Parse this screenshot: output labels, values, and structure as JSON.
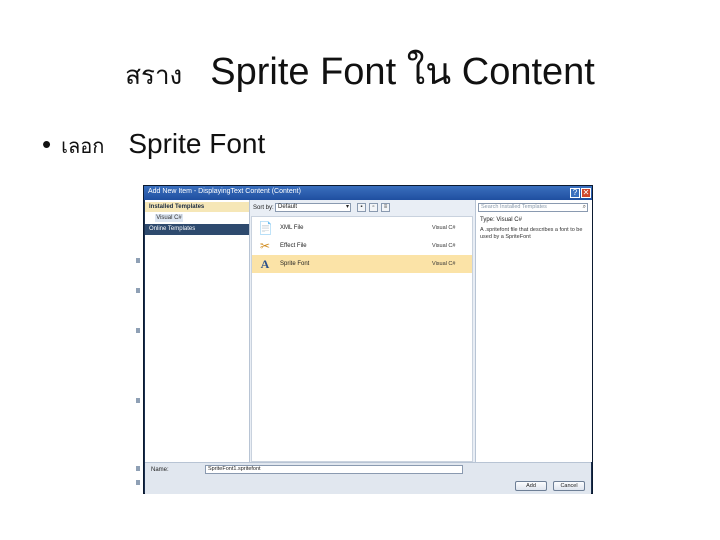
{
  "slide": {
    "title_thai": "สราง",
    "title_main": "Sprite Font ใน Content",
    "bullet_thai": "เลอก",
    "bullet_main": "Sprite Font"
  },
  "dialog": {
    "title": "Add New Item - DisplayingText Content (Content)",
    "help_label": "?",
    "close_label": "✕",
    "left_pane": {
      "installed_templates": "Installed Templates",
      "visual_csharp": "Visual C#",
      "online_templates": "Online Templates"
    },
    "toolbar": {
      "sort_by_label": "Sort by:",
      "sort_by_value": "Default",
      "dropdown_arrow": "▾"
    },
    "templates": [
      {
        "name": "XML File",
        "lang": "Visual C#",
        "icon": "xml-file-icon",
        "glyph": "📄",
        "color": "#5b7fb3",
        "selected": false
      },
      {
        "name": "Effect File",
        "lang": "Visual C#",
        "icon": "effect-file-icon",
        "glyph": "✂",
        "color": "#d08a1c",
        "selected": false
      },
      {
        "name": "Sprite Font",
        "lang": "Visual C#",
        "icon": "sprite-font-icon",
        "glyph": "A",
        "color": "#2a4f8a",
        "selected": true
      }
    ],
    "right_pane": {
      "search_placeholder": "Search Installed Templates",
      "type_line": "Type: Visual C#",
      "description": "A .spritefont file that describes a font to be used by a SpriteFont"
    },
    "bottom": {
      "name_label": "Name:",
      "name_value": "SpriteFont1.spritefont",
      "add_label": "Add",
      "cancel_label": "Cancel"
    }
  },
  "colors": {
    "selected_row": "#fbe3a7",
    "titlebar": "#1f4fa0",
    "online_templates_bg": "#2e4a6e"
  }
}
